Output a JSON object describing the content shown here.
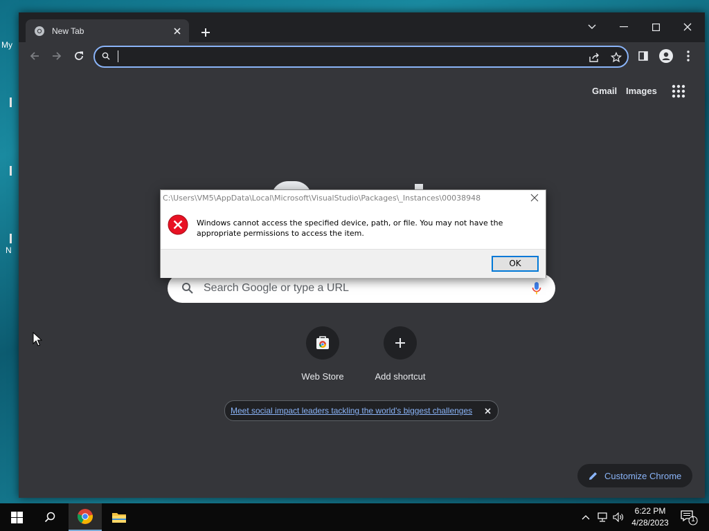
{
  "desktop": {
    "labels": [
      "My",
      "N"
    ]
  },
  "browser": {
    "tab": {
      "title": "New Tab"
    },
    "omnibox": {
      "value": "",
      "placeholder": ""
    },
    "ntp": {
      "top_links": {
        "gmail": "Gmail",
        "images": "Images"
      },
      "search_placeholder": "Search Google or type a URL",
      "shortcuts": [
        {
          "label": "Web Store"
        },
        {
          "label": "Add shortcut"
        }
      ],
      "promo_link": "Meet social impact leaders tackling the world's biggest challenges",
      "customize_label": "Customize Chrome"
    }
  },
  "dialog": {
    "title": "C:\\Users\\VM5\\AppData\\Local\\Microsoft\\VisualStudio\\Packages\\_Instances\\00038948",
    "message": "Windows cannot access the specified device, path, or file. You may not have the appropriate permissions to access the item.",
    "ok_label": "OK"
  },
  "taskbar": {
    "time": "6:22 PM",
    "date": "4/28/2023",
    "notification_count": "1"
  },
  "colors": {
    "accent": "#8ab4f8",
    "browser_bg": "#35363a",
    "error_red": "#e81123"
  }
}
